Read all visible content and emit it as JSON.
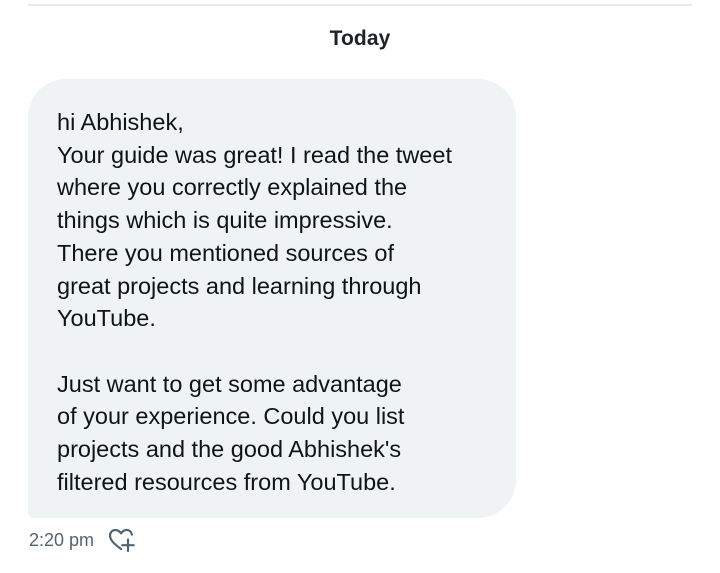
{
  "date_separator": "Today",
  "message": {
    "lines": [
      "hi Abhishek,",
      "Your guide was great! I read the tweet",
      "where you correctly explained the",
      "things which is quite impressive.",
      "There you mentioned sources of",
      "great projects and learning through",
      "YouTube.",
      "",
      "Just want to get some advantage",
      "of your experience. Could you list",
      "projects and the good Abhishek's",
      "filtered resources from YouTube."
    ],
    "timestamp": "2:20 pm",
    "reaction_icon": "add-reaction-heart-icon"
  },
  "colors": {
    "bubble_background": "#eff3f4",
    "text": "#0f1419",
    "secondary_text": "#536471",
    "divider": "#e7e9ea"
  }
}
